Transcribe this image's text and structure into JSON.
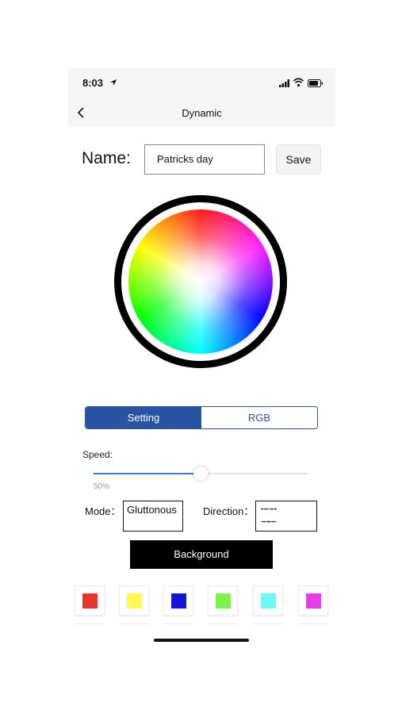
{
  "status_bar": {
    "time": "8:03"
  },
  "nav": {
    "title": "Dynamic",
    "back_icon": "chevron-left-icon"
  },
  "name_row": {
    "label": "Name:",
    "value": "Patricks day",
    "save_label": "Save"
  },
  "color_wheel": {
    "name": "color-wheel"
  },
  "tabs": [
    {
      "label": "Setting",
      "active": true
    },
    {
      "label": "RGB",
      "active": false
    }
  ],
  "speed": {
    "label": "Speed:",
    "value_text": "50%",
    "value": 0.5
  },
  "mode": {
    "label": "Mode：",
    "value": "Gluttonous"
  },
  "direction": {
    "label": "Direction：",
    "line1": "←←→→",
    "line2": "→→←←"
  },
  "background_button": "Background",
  "swatches": [
    {
      "name": "red",
      "color": "#e8352b"
    },
    {
      "name": "yellow",
      "color": "#fffa52"
    },
    {
      "name": "blue",
      "color": "#1414d8"
    },
    {
      "name": "green",
      "color": "#7cf24a"
    },
    {
      "name": "cyan",
      "color": "#6ef8f8"
    },
    {
      "name": "magenta",
      "color": "#e83de8"
    }
  ],
  "colors": {
    "accent": "#2855a3",
    "slider": "#3a7bd5"
  }
}
